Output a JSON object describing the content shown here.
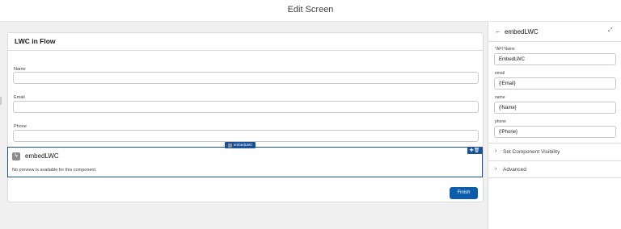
{
  "header": {
    "title": "Edit Screen"
  },
  "screen": {
    "card_title": "LWC in Flow",
    "fields": [
      {
        "label": "Name",
        "value": ""
      },
      {
        "label": "Email",
        "value": ""
      },
      {
        "label": "Phone",
        "value": ""
      }
    ],
    "component": {
      "tag_label": "embedLWC",
      "name": "embedLWC",
      "message": "No preview is available for this component.",
      "icon": "lightning-icon",
      "tools": "✚🗑"
    },
    "finish_label": "Finish"
  },
  "panel": {
    "title": "embedLWC",
    "api_name_label": "API Name",
    "api_name_required": "*",
    "api_name_value": "EmbedLWC",
    "props": [
      {
        "label": "email",
        "value": "{!Email}"
      },
      {
        "label": "name",
        "value": "{!Name}"
      },
      {
        "label": "phone",
        "value": "{!Phone}"
      }
    ],
    "sections": [
      {
        "label": "Set Component Visibility"
      },
      {
        "label": "Advanced"
      }
    ]
  },
  "colors": {
    "accent": "#1b5297",
    "button": "#0b5cab",
    "canvas": "#f0f0f0"
  }
}
